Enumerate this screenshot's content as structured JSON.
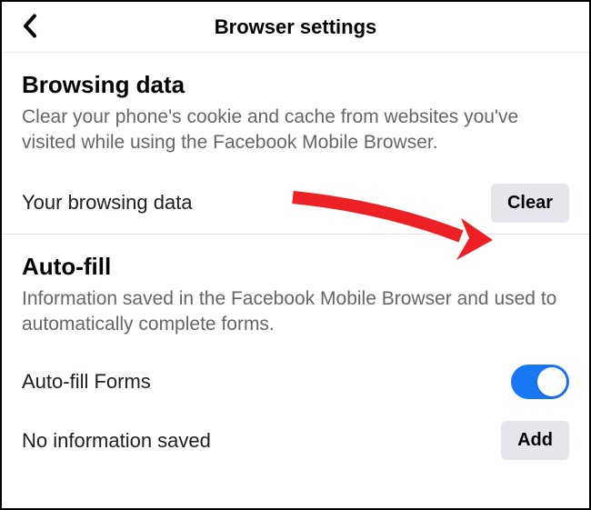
{
  "header": {
    "title": "Browser settings"
  },
  "browsing_data": {
    "title": "Browsing data",
    "description": "Clear your phone's cookie and cache from websites you've visited while using the Facebook Mobile Browser.",
    "row_label": "Your browsing data",
    "clear_label": "Clear"
  },
  "autofill": {
    "title": "Auto-fill",
    "description": "Information saved in the Facebook Mobile Browser and used to automatically complete forms.",
    "forms_label": "Auto-fill Forms",
    "empty_label": "No information saved",
    "add_label": "Add",
    "toggle_on": true
  },
  "colors": {
    "accent": "#1877f2",
    "button_grey": "#e4e6eb",
    "text_secondary": "#666",
    "annotation": "#ed2024"
  }
}
